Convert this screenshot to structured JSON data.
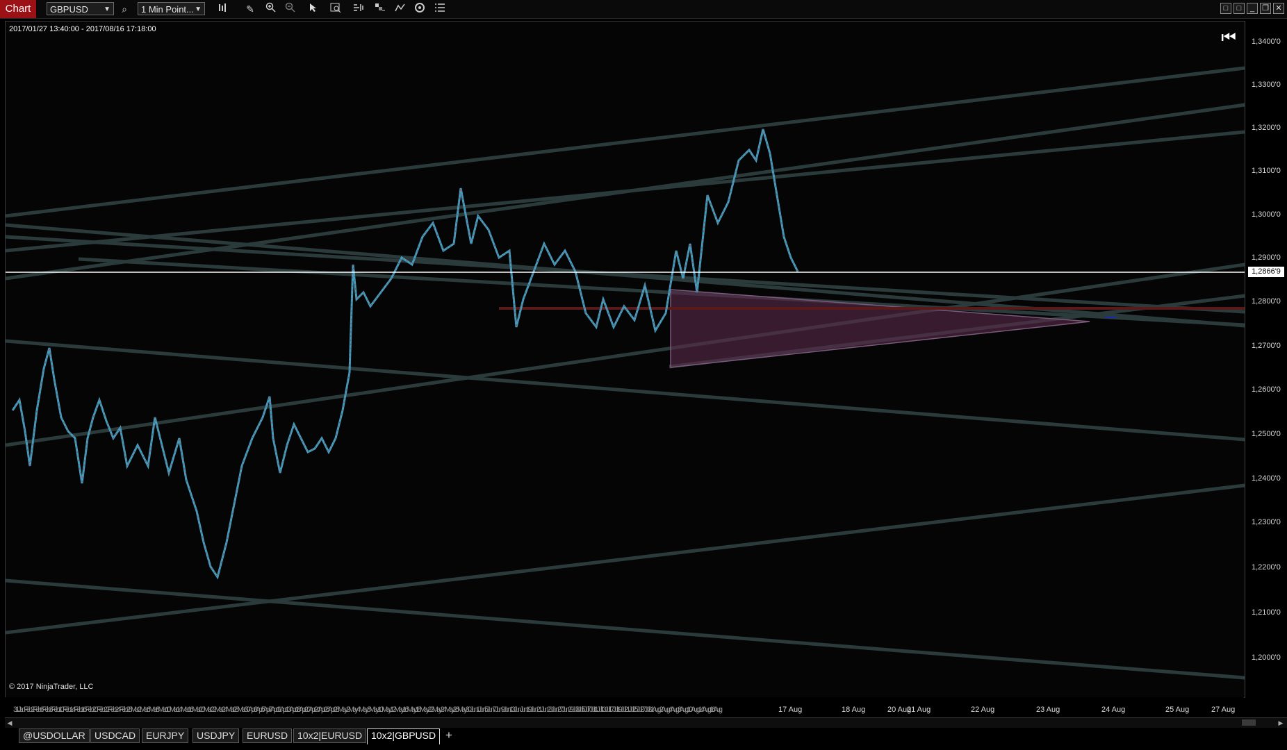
{
  "toolbar": {
    "title": "Chart",
    "instrument": "GBPUSD",
    "timeframe": "1 Min Point..."
  },
  "chart": {
    "date_range": "2017/01/27 13:40:00 - 2017/08/16 17:18:00",
    "copyright": "© 2017 NinjaTrader, LLC",
    "current_price": "1,2866'9",
    "price_labels": [
      "1,3400'0",
      "1,3300'0",
      "1,3200'0",
      "1,3100'0",
      "1,3000'0",
      "1,2900'0",
      "1,2800'0",
      "1,2700'0",
      "1,2600'0",
      "1,2500'0",
      "1,2400'0",
      "1,2300'0",
      "1,2200'0",
      "1,2100'0",
      "1,2000'0"
    ],
    "time_labels": [
      "17 Aug",
      "18 Aug",
      "20 Aug",
      "21 Aug",
      "22 Aug",
      "23 Aug",
      "24 Aug",
      "25 Aug",
      "27 Aug"
    ],
    "crowded_dates": "31 Jan Feb 2 Feb 6 Feb 8 Feb 10 Feb 14 Feb 16 Feb 20 Feb 22 Feb 24 Feb 28 Mar 2 Mar 6 Mar 8 Mar 10 Mar 14 Mar 16 Mar 20 Mar 22 Mar 24 Mar 28 Mar 30 Apr 3 Apr 5 Apr 7 Apr 11 Apr 13 Apr 18 Apr 20 Apr 24 Apr 26 Apr 28 May 2 May 4 May 8 May 10 May 12 May 16 May 18 May 22 May 24 May 26 May 30 Jun 1 Jun 5 Jun 7 Jun 9 Jun 13 Jun Jun 19 Jun 21 Jun 23 Jun 27 Jun 29 Jul 3 Jul 5 Jul 7 Jul 11 Jul 13 Jul 17 Jul 19 Jul 21 Jul 25 Jul 27 Jul 31 Aug 2 Aug 4 Aug 8 Aug 10 Aug 14 Aug 16 Aug"
  },
  "tabs": [
    {
      "label": "@USDOLLAR",
      "active": false
    },
    {
      "label": "USDCAD",
      "active": false
    },
    {
      "label": "EURJPY",
      "active": false
    },
    {
      "label": "USDJPY",
      "active": false
    },
    {
      "label": "EURUSD",
      "active": false
    },
    {
      "label": "10x2|EURUSD",
      "active": false
    },
    {
      "label": "10x2|GBPUSD",
      "active": true
    }
  ],
  "add_tab_label": "+",
  "colors": {
    "brand": "#9c1116",
    "trendline": "#2b3b3b",
    "candle_up": "#3c9fbf",
    "candle_down": "#b03a4e",
    "zone": "#5a2a4a",
    "current_price_line": "#ffffff"
  },
  "icons": [
    "search-icon",
    "draw-pencil-icon",
    "zoom-in-icon",
    "zoom-out-icon",
    "pointer-icon",
    "data-box-icon",
    "bar-spacing-icon",
    "bar-type-icon",
    "indicator-icon",
    "strategy-icon",
    "list-icon",
    "bars-icon"
  ]
}
